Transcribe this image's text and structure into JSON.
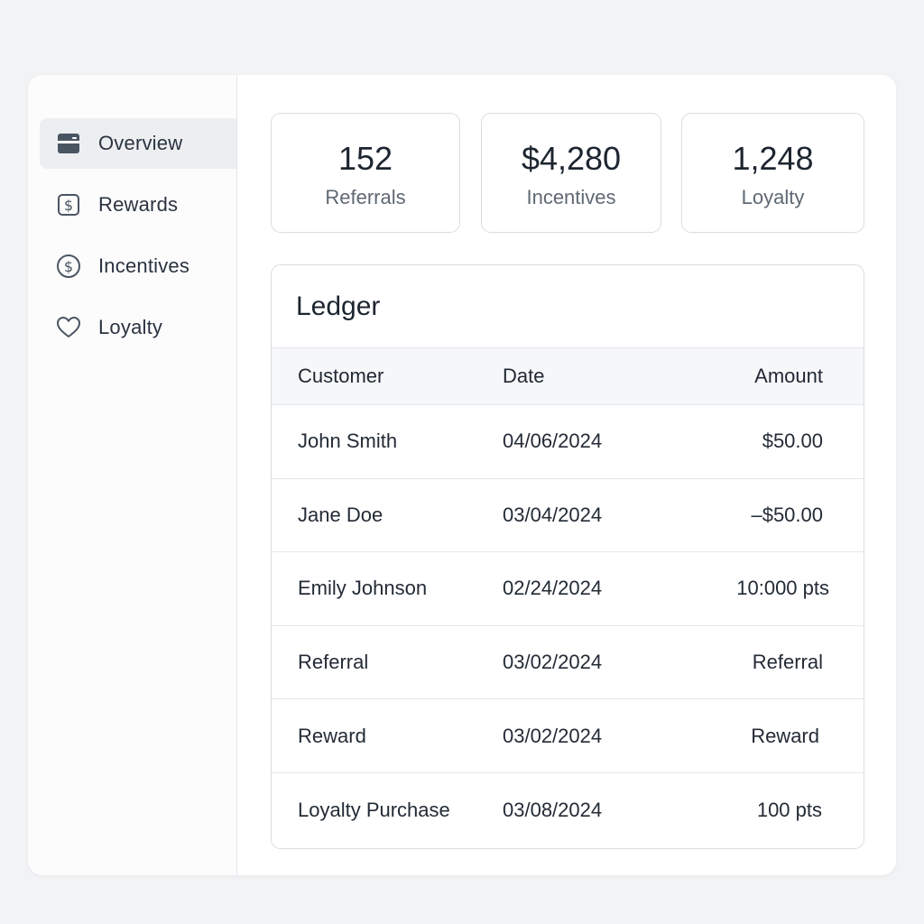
{
  "sidebar": {
    "items": [
      {
        "label": "Overview",
        "icon": "card-icon",
        "active": true
      },
      {
        "label": "Rewards",
        "icon": "dollar-square-icon",
        "active": false
      },
      {
        "label": "Incentives",
        "icon": "dollar-circle-icon",
        "active": false
      },
      {
        "label": "Loyalty",
        "icon": "heart-icon",
        "active": false
      }
    ]
  },
  "stats": [
    {
      "value": "152",
      "label": "Referrals"
    },
    {
      "value": "$4,280",
      "label": "Incentives"
    },
    {
      "value": "1,248",
      "label": "Loyalty"
    }
  ],
  "ledger": {
    "title": "Ledger",
    "columns": [
      "Customer",
      "Date",
      "Amount"
    ],
    "rows": [
      {
        "customer": "John Smith",
        "date": "04/06/2024",
        "amount": "$50.00"
      },
      {
        "customer": "Jane Doe",
        "date": "03/04/2024",
        "amount": "–$50.00"
      },
      {
        "customer": "Emily Johnson",
        "date": "02/24/2024",
        "amount": "10:000 pts"
      },
      {
        "customer": "Referral",
        "date": "03/02/2024",
        "amount": "Referral"
      },
      {
        "customer": "Reward",
        "date": "03/02/2024",
        "amount": "Reward"
      },
      {
        "customer": "Loyalty Purchase",
        "date": "03/08/2024",
        "amount": "100 pts"
      }
    ]
  },
  "colors": {
    "background": "#f2f3f5",
    "card": "#ffffff",
    "border": "#d9dde2",
    "active_nav": "#eceef1",
    "icon": "#4a5562",
    "text": "#1f2733",
    "muted": "#5f6873"
  }
}
